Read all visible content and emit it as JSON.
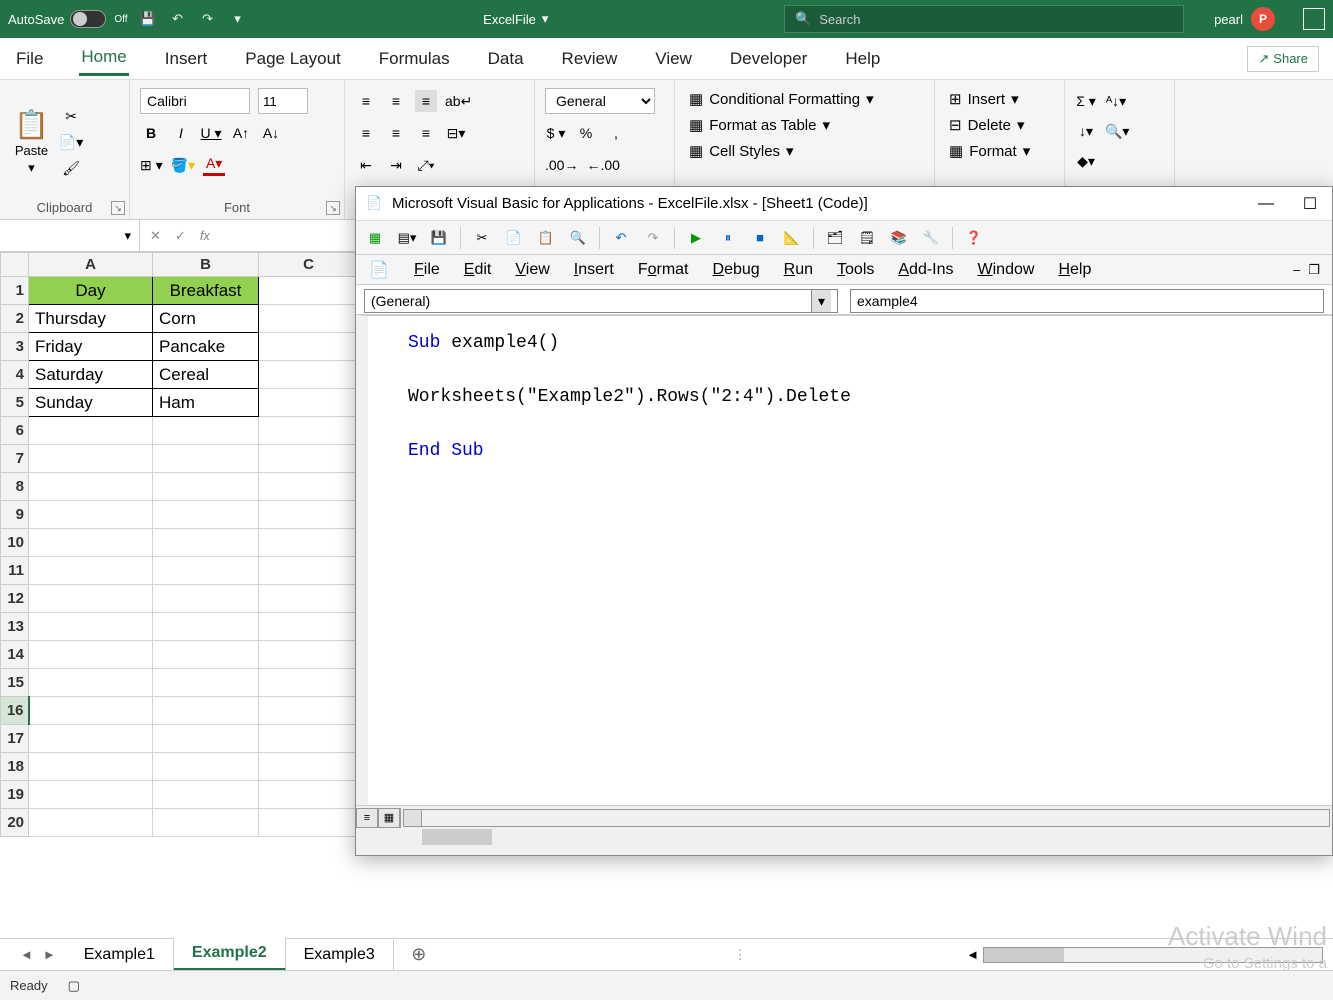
{
  "titlebar": {
    "autosave_label": "AutoSave",
    "autosave_state": "Off",
    "filename": "ExcelFile",
    "search_placeholder": "Search",
    "username": "pearl",
    "user_initial": "P"
  },
  "ribbon": {
    "tabs": [
      "File",
      "Home",
      "Insert",
      "Page Layout",
      "Formulas",
      "Data",
      "Review",
      "View",
      "Developer",
      "Help"
    ],
    "active_tab": "Home",
    "share": "Share",
    "clipboard": {
      "paste": "Paste",
      "group": "Clipboard"
    },
    "font": {
      "name": "Calibri",
      "size": "11",
      "group": "Font"
    },
    "number": {
      "format": "General"
    },
    "styles": {
      "cond": "Conditional Formatting",
      "table": "Format as Table",
      "cell": "Cell Styles"
    },
    "cells": {
      "insert": "Insert",
      "delete": "Delete",
      "format": "Format"
    }
  },
  "formula_bar": {
    "name_box": "",
    "fx": "fx"
  },
  "grid": {
    "columns": [
      "A",
      "B",
      "C"
    ],
    "headers": [
      "Day",
      "Breakfast"
    ],
    "rows": [
      [
        "Thursday",
        "Corn"
      ],
      [
        "Friday",
        "Pancake"
      ],
      [
        "Saturday",
        "Cereal"
      ],
      [
        "Sunday",
        "Ham"
      ]
    ],
    "row_count": 20,
    "selected_row": 16
  },
  "sheet_tabs": {
    "tabs": [
      "Example1",
      "Example2",
      "Example3"
    ],
    "active": "Example2"
  },
  "status_bar": {
    "ready": "Ready"
  },
  "vba": {
    "title": "Microsoft Visual Basic for Applications - ExcelFile.xlsx - [Sheet1 (Code)]",
    "menu": [
      "File",
      "Edit",
      "View",
      "Insert",
      "Format",
      "Debug",
      "Run",
      "Tools",
      "Add-Ins",
      "Window",
      "Help"
    ],
    "dd_left": "(General)",
    "dd_right": "example4",
    "code": {
      "l1a": "Sub ",
      "l1b": "example4()",
      "l2": "Worksheets(\"Example2\").Rows(\"2:4\").Delete",
      "l3": "End Sub"
    }
  },
  "watermark": {
    "title": "Activate Wind",
    "sub": "Go to Settings to a"
  }
}
